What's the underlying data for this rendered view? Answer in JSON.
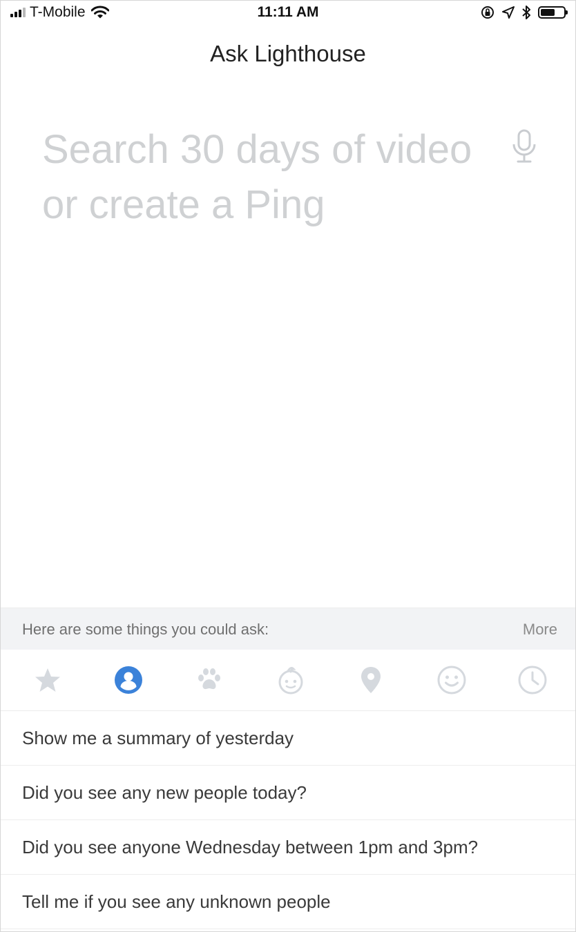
{
  "status_bar": {
    "carrier": "T-Mobile",
    "time": "11:11 AM"
  },
  "header": {
    "title": "Ask Lighthouse"
  },
  "search": {
    "placeholder": "Search 30 days of video\nor create a Ping"
  },
  "suggest_bar": {
    "label": "Here are some things you could ask:",
    "more": "More"
  },
  "categories": [
    {
      "icon": "star-icon",
      "selected": false
    },
    {
      "icon": "person-icon",
      "selected": true
    },
    {
      "icon": "paw-icon",
      "selected": false
    },
    {
      "icon": "baby-icon",
      "selected": false
    },
    {
      "icon": "location-pin-icon",
      "selected": false
    },
    {
      "icon": "smiley-icon",
      "selected": false
    },
    {
      "icon": "clock-icon",
      "selected": false
    }
  ],
  "suggestions": [
    "Show me a summary of yesterday",
    "Did you see any new people today?",
    "Did you see anyone Wednesday between 1pm and 3pm?",
    "Tell me if you see any unknown people"
  ],
  "colors": {
    "accent": "#3b82d9",
    "icon_inactive": "#d5d9de",
    "placeholder": "#cfd1d3"
  }
}
